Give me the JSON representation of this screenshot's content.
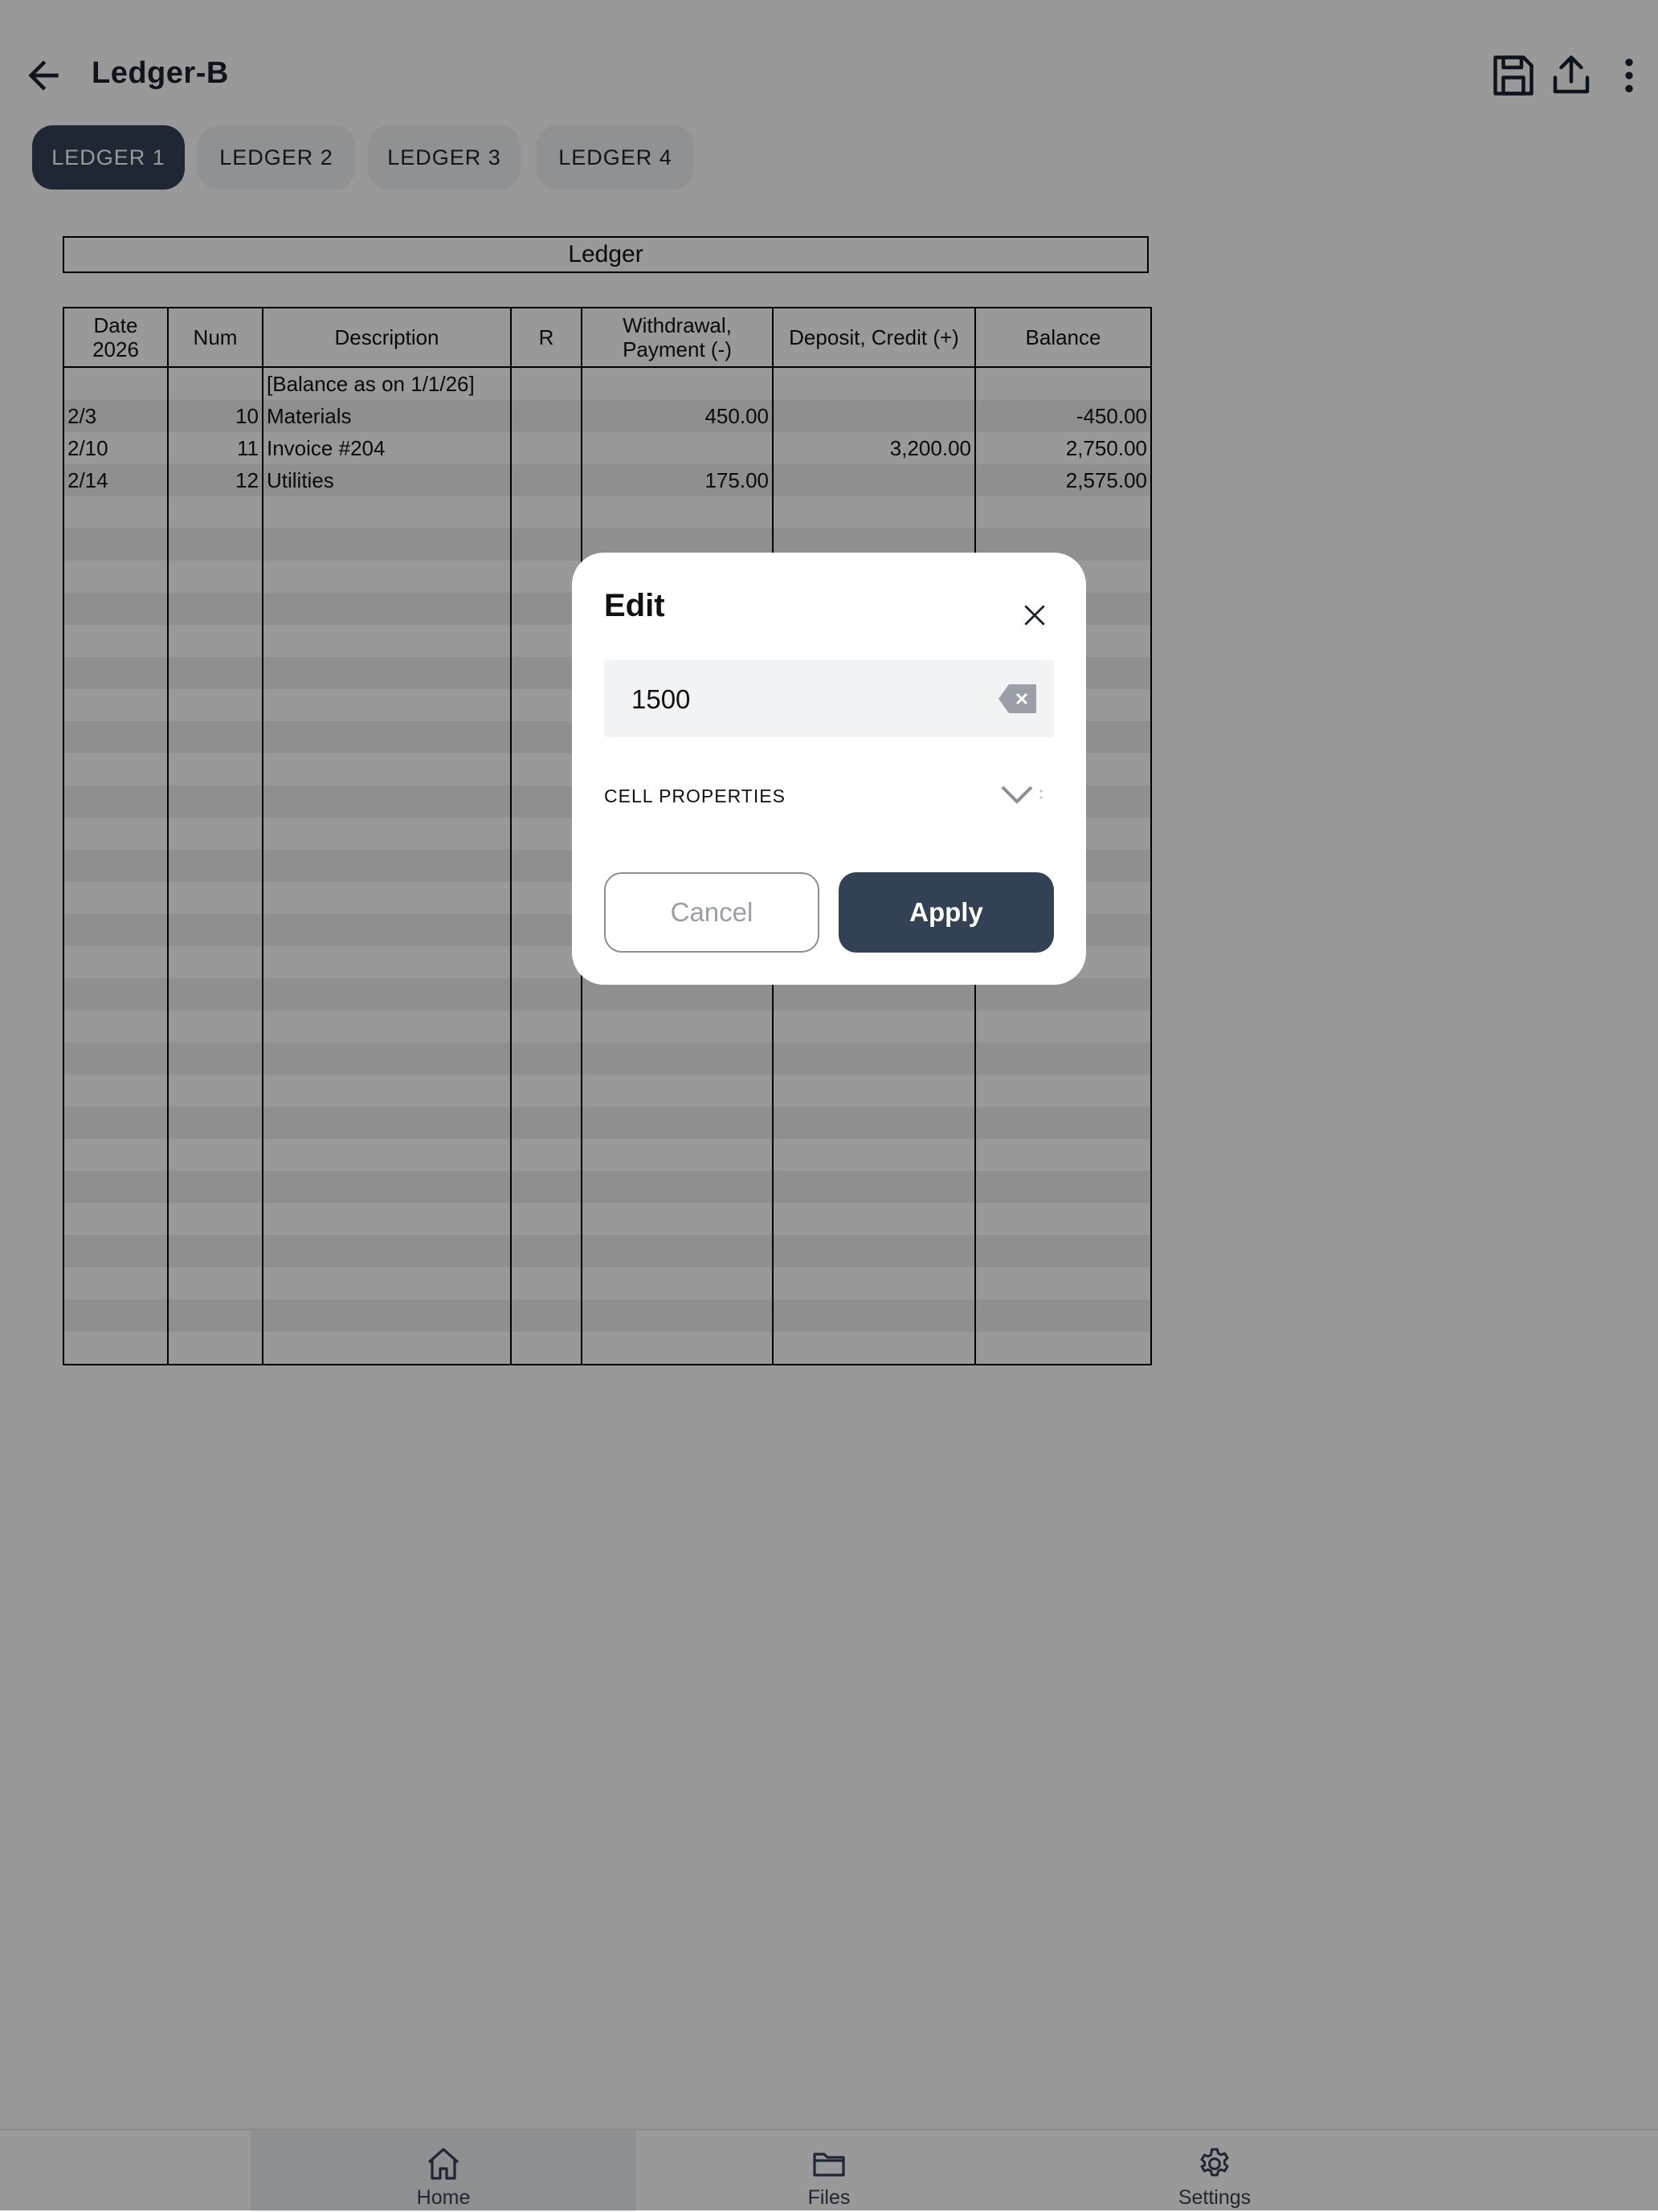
{
  "app": {
    "title": "Ledger-B",
    "actions": [
      "save-icon",
      "share-icon",
      "more-vert-icon"
    ]
  },
  "tabs": [
    "LEDGER 1",
    "LEDGER 2",
    "LEDGER 3",
    "LEDGER 4"
  ],
  "active_tab": "LEDGER 1",
  "sheet": {
    "title": "Ledger",
    "headers": [
      "Date 2026",
      "Num",
      "Description",
      "R",
      "Withdrawal, Payment (-)",
      "Deposit, Credit (+)",
      "Balance"
    ],
    "rows": [
      {
        "date": "",
        "num": "",
        "desc": "[Balance as on 1/1/26]",
        "r": "",
        "withdrawal": "",
        "deposit": "",
        "balance": ""
      },
      {
        "date": "2/3",
        "num": "10",
        "desc": "Materials",
        "r": "",
        "withdrawal": "450.00",
        "deposit": "",
        "balance": "-450.00"
      },
      {
        "date": "2/10",
        "num": "11",
        "desc": "Invoice #204",
        "r": "",
        "withdrawal": "",
        "deposit": "3,200.00",
        "balance": "2,750.00"
      },
      {
        "date": "2/14",
        "num": "12",
        "desc": "Utilities",
        "r": "",
        "withdrawal": "175.00",
        "deposit": "",
        "balance": "2,575.00"
      }
    ],
    "empty_rows": 27
  },
  "dialog": {
    "title": "Edit",
    "value": "1500",
    "cell_properties_label": "CELL PROPERTIES",
    "cancel_label": "Cancel",
    "apply_label": "Apply"
  },
  "bottom_nav": [
    {
      "label": "Home",
      "icon": "home-icon",
      "active": true
    },
    {
      "label": "Files",
      "icon": "folder-icon",
      "active": false
    },
    {
      "label": "Settings",
      "icon": "gear-icon",
      "active": false
    }
  ],
  "colors": {
    "accent": "#334155",
    "stripe": "#eeeeee",
    "scrim": "rgba(0,0,0,0.4)"
  }
}
